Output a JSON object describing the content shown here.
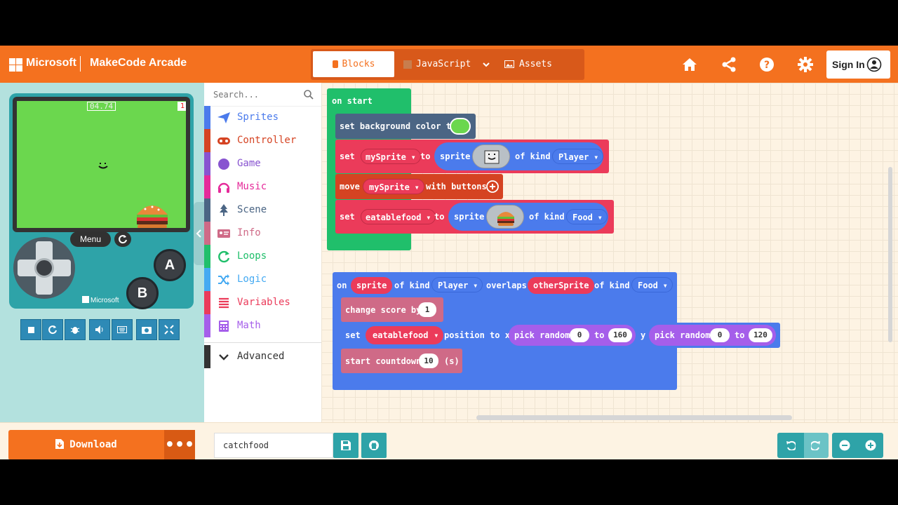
{
  "header": {
    "brand": "Microsoft",
    "app_title": "MakeCode Arcade",
    "tabs": [
      {
        "label": "Blocks"
      },
      {
        "label": "JavaScript"
      },
      {
        "label": "Assets"
      }
    ],
    "signin_label": "Sign In",
    "icons": [
      "home-icon",
      "share-icon",
      "help-icon",
      "settings-icon"
    ]
  },
  "simulator": {
    "countdown": "04.74",
    "score": "1",
    "menu_label": "Menu",
    "button_a": "A",
    "button_b": "B",
    "brand": "Microsoft"
  },
  "toolbox": {
    "search_placeholder": "Search...",
    "categories": [
      {
        "label": "Sprites",
        "color": "#4b7bec",
        "icon": "paper-plane-icon"
      },
      {
        "label": "Controller",
        "color": "#d54322",
        "icon": "gamepad-icon"
      },
      {
        "label": "Game",
        "color": "#8854d0",
        "icon": "circle-icon"
      },
      {
        "label": "Music",
        "color": "#e52a9a",
        "icon": "headphones-icon"
      },
      {
        "label": "Scene",
        "color": "#4b6584",
        "icon": "tree-icon"
      },
      {
        "label": "Info",
        "color": "#cf6a87",
        "icon": "id-card-icon"
      },
      {
        "label": "Loops",
        "color": "#20bf6b",
        "icon": "loop-icon"
      },
      {
        "label": "Logic",
        "color": "#45aaf2",
        "icon": "shuffle-icon"
      },
      {
        "label": "Variables",
        "color": "#eb3b5a",
        "icon": "list-icon"
      },
      {
        "label": "Math",
        "color": "#a55eea",
        "icon": "calculator-icon"
      }
    ],
    "advanced_label": "Advanced"
  },
  "blocks": {
    "on_start": "on start",
    "set_bg": "set background color to",
    "set": "set",
    "to": "to",
    "sprite": "sprite",
    "of_kind": "of kind",
    "mySprite": "mySprite",
    "player": "Player",
    "move": "move",
    "with_buttons": "with buttons",
    "eatablefood": "eatablefood",
    "food": "Food",
    "on": "on",
    "overlaps": "overlaps",
    "otherSprite": "otherSprite",
    "change_score": "change score by",
    "score_val": "1",
    "position_to_x": "position to x",
    "pick_random": "pick random",
    "r0": "0",
    "r160": "160",
    "y": "y",
    "r120": "120",
    "start_countdown": "start countdown",
    "countdown_val": "10",
    "seconds": "(s)"
  },
  "bottom": {
    "download_label": "Download",
    "project_name": "catchfood"
  }
}
